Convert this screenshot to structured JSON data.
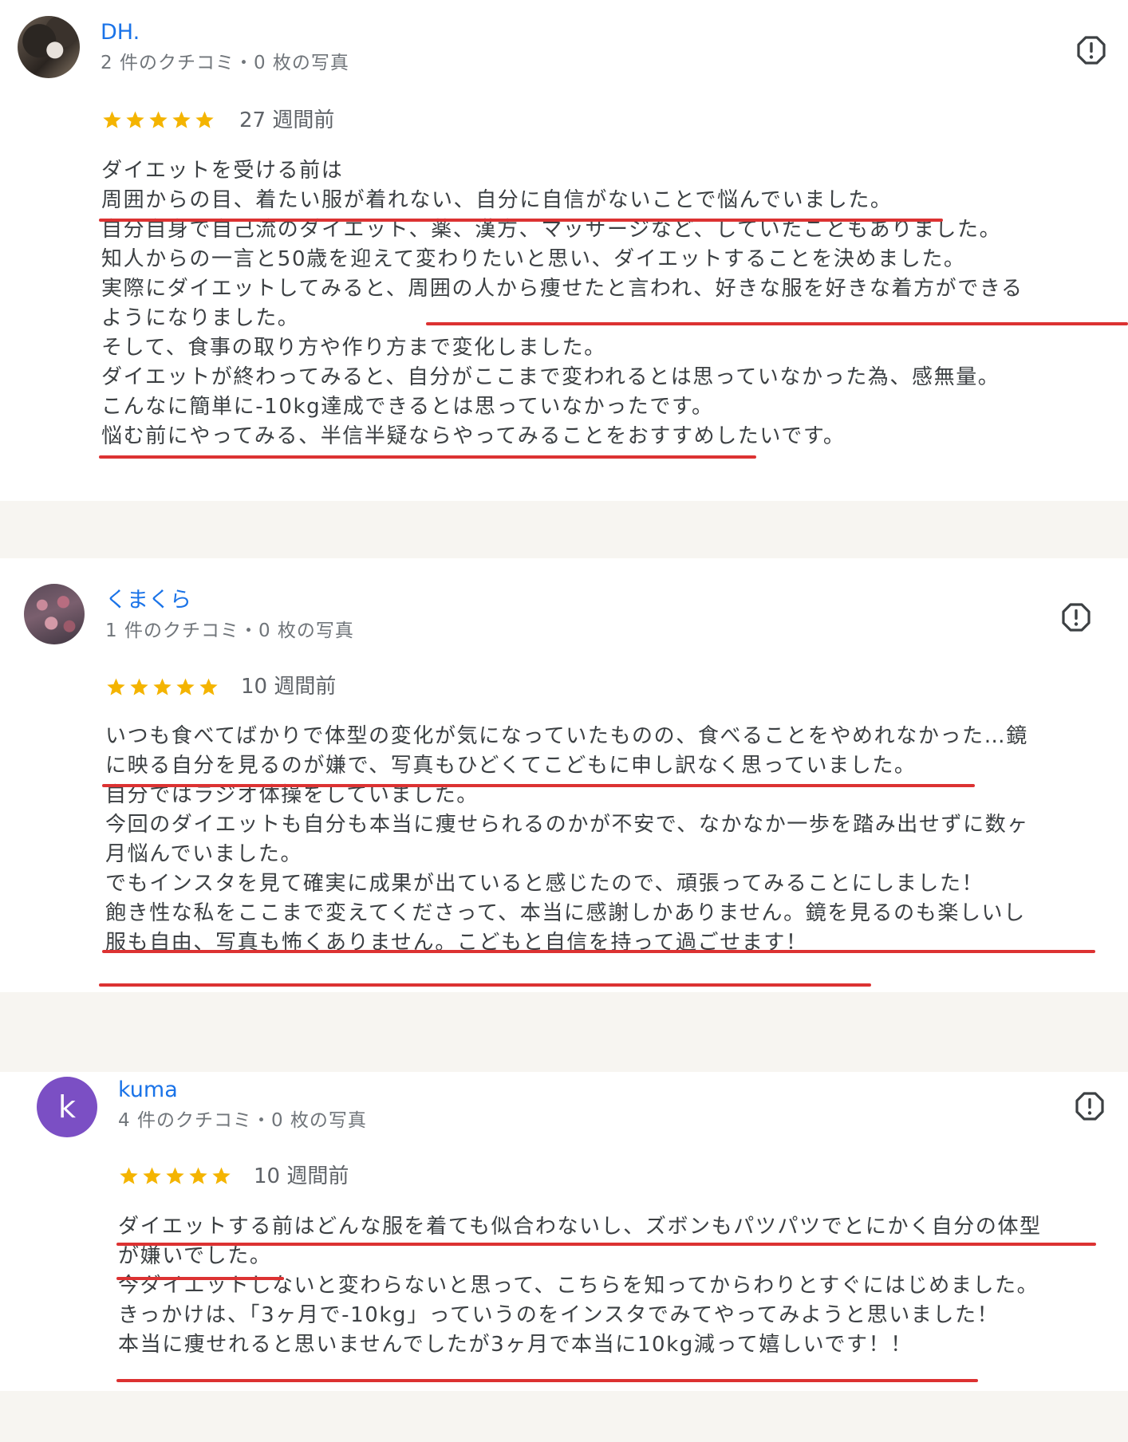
{
  "accent_color": "#1a73e8",
  "underline_color": "#dc3232",
  "star_color": "#f4b400",
  "reviews": [
    {
      "name": "DH.",
      "meta": "2 件のクチコミ・0 枚の写真",
      "avatar": "dog-photo",
      "rating": 5,
      "time": "27 週間前",
      "lines": [
        "ダイエットを受ける前は",
        "周囲からの目、着たい服が着れない、自分に自信がないことで悩んでいました。",
        "自分自身で自己流のダイエット、薬、漢方、マッサージなど、していたこともありました。",
        "知人からの一言と50歳を迎えて変わりたいと思い、ダイエットすることを決めました。",
        "実際にダイエットしてみると、周囲の人から痩せたと言われ、好きな服を好きな着方ができる",
        "ようになりました。",
        "そして、食事の取り方や作り方まで変化しました。",
        "ダイエットが終わってみると、自分がここまで変われるとは思っていなかった為、感無量。",
        "こんなに簡単に-10kg達成できるとは思っていなかったです。",
        "悩む前にやってみる、半信半疑ならやってみることをおすすめしたいです。"
      ]
    },
    {
      "name": "くまくら",
      "meta": "1 件のクチコミ・0 枚の写真",
      "avatar": "blossom-photo",
      "rating": 5,
      "time": "10 週間前",
      "lines": [
        "いつも食べてばかりで体型の変化が気になっていたものの、食べることをやめれなかった…鏡",
        "に映る自分を見るのが嫌で、写真もひどくてこどもに申し訳なく思っていました。",
        "自分ではラジオ体操をしていました。",
        "今回のダイエットも自分も本当に痩せられるのかが不安で、なかなか一歩を踏み出せずに数ヶ",
        "月悩んでいました。",
        "でもインスタを見て確実に成果が出ていると感じたので、頑張ってみることにしました！",
        "飽き性な私をここまで変えてくださって、本当に感謝しかありません。鏡を見るのも楽しいし",
        "服も自由、写真も怖くありません。こどもと自信を持って過ごせます！"
      ]
    },
    {
      "name": "kuma",
      "meta": "4 件のクチコミ・0 枚の写真",
      "avatar_letter": "k",
      "rating": 5,
      "time": "10 週間前",
      "lines": [
        "ダイエットする前はどんな服を着ても似合わないし、ズボンもパツパツでとにかく自分の体型",
        "が嫌いでした。",
        "今ダイエットしないと変わらないと思って、こちらを知ってからわりとすぐにはじめました。",
        "きっかけは、「3ヶ月で-10kg」っていうのをインスタでみてやってみようと思いました！",
        "本当に痩せれると思いませんでしたが3ヶ月で本当に10kg減って嬉しいです！！"
      ]
    }
  ]
}
